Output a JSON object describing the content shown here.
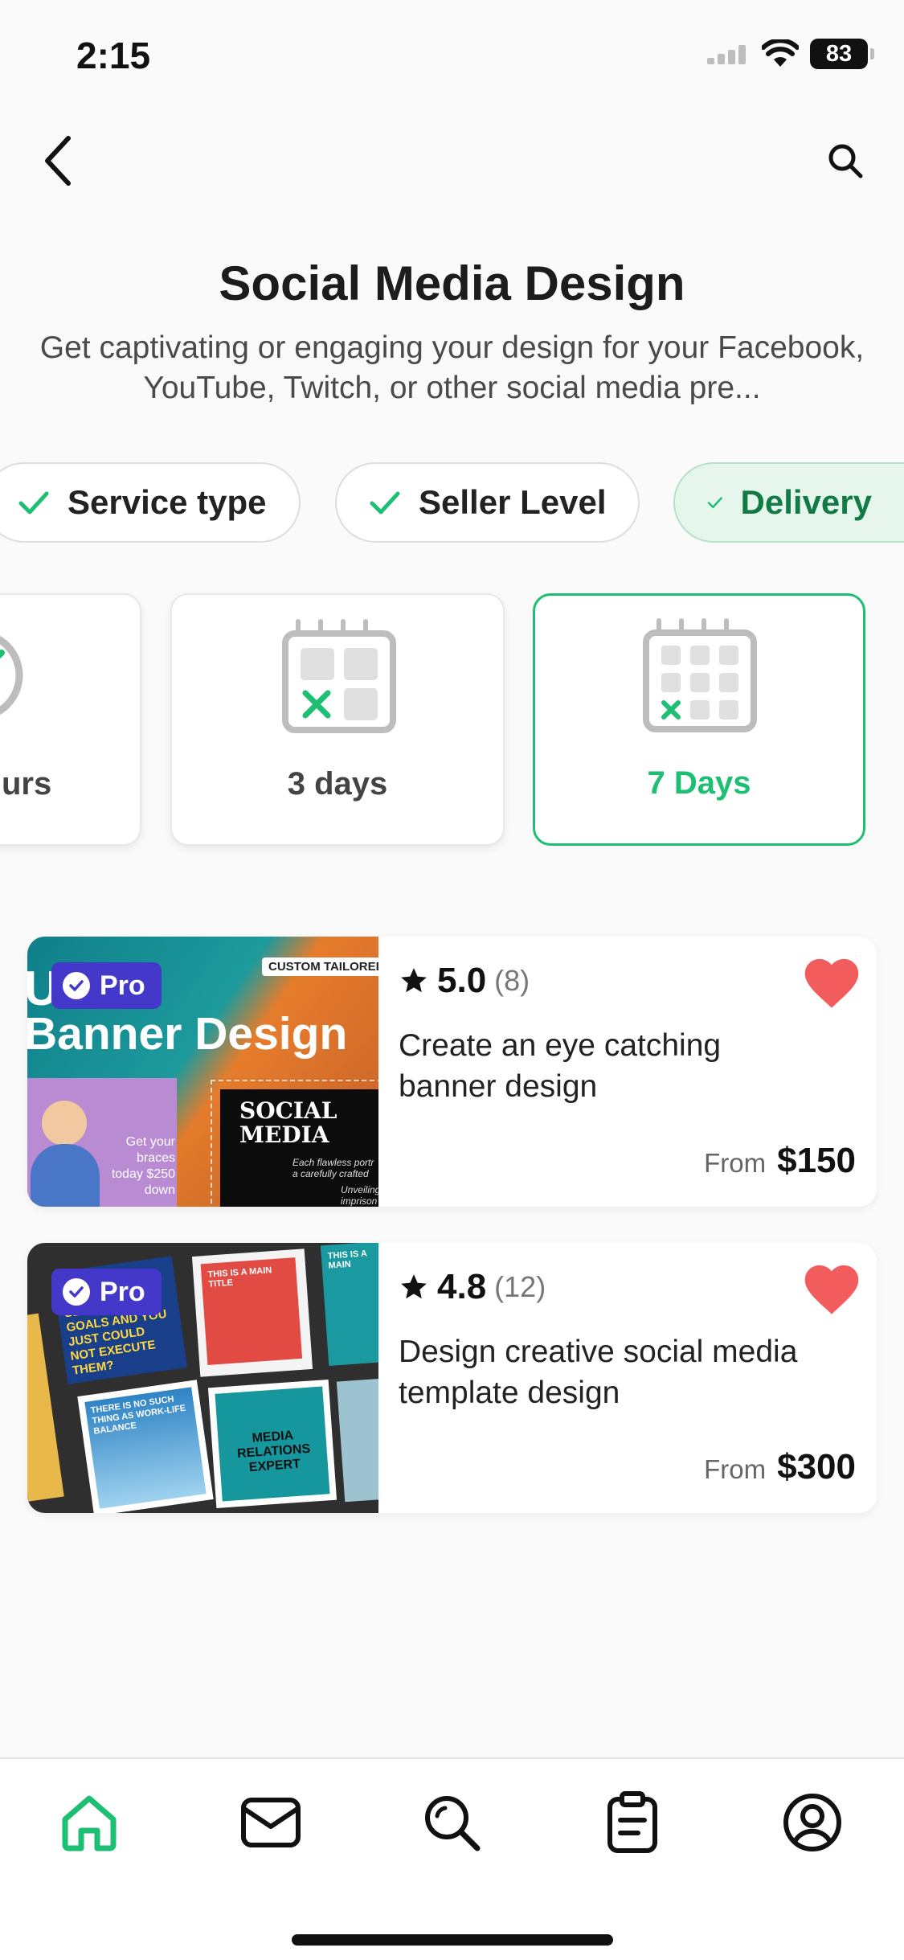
{
  "status_bar": {
    "time": "2:15",
    "battery": "83"
  },
  "header": {
    "title": "Social Media Design",
    "description": "Get captivating or engaging your design for your Facebook, YouTube, Twitch, or other social media pre..."
  },
  "filters": [
    {
      "label": "Service type",
      "active": false
    },
    {
      "label": "Seller Level",
      "active": false
    },
    {
      "label": "Delivery",
      "active": true
    }
  ],
  "delivery_options": [
    {
      "label": "urs",
      "icon": "clock-icon",
      "selected": false
    },
    {
      "label": "3 days",
      "icon": "calendar-3days-icon",
      "selected": false
    },
    {
      "label": "7 Days",
      "icon": "calendar-7days-icon",
      "selected": true
    }
  ],
  "gigs": [
    {
      "badge": "Pro",
      "rating": "5.0",
      "reviews": "(8)",
      "title": "Create an eye catching banner design",
      "from_label": "From",
      "price": "$150",
      "favorited": true,
      "image_text": {
        "tag": "CUSTOM TAILORED",
        "line1": "U    e",
        "line2": "Banner Design",
        "social": "SOCIAL MEDIA",
        "caption": "Get your braces today $250 down",
        "italic1": "Each flawless portr a carefully crafted",
        "italic2": "Unveiling imprison"
      }
    },
    {
      "badge": "Pro",
      "rating": "4.8",
      "reviews": "(12)",
      "title": "Design creative social media template design",
      "from_label": "From",
      "price": "$300",
      "favorited": true,
      "image_text": {
        "t1": "SET YOUR GOALS AND YOU JUST COULD NOT EXECUTE THEM?",
        "t2": "THIS IS A MAIN TITLE",
        "t3": "THERE IS NO SUCH THING AS WORK-LIFE BALANCE",
        "t4": "MEDIA RELATIONS EXPERT",
        "t5": "THIS IS A MAIN"
      }
    }
  ],
  "colors": {
    "accent": "#1dbf73",
    "pro": "#4338ca",
    "heart": "#f25c5c"
  },
  "nav": [
    {
      "icon": "home-icon",
      "active": true
    },
    {
      "icon": "mail-icon",
      "active": false
    },
    {
      "icon": "search-icon",
      "active": false
    },
    {
      "icon": "orders-icon",
      "active": false
    },
    {
      "icon": "profile-icon",
      "active": false
    }
  ]
}
